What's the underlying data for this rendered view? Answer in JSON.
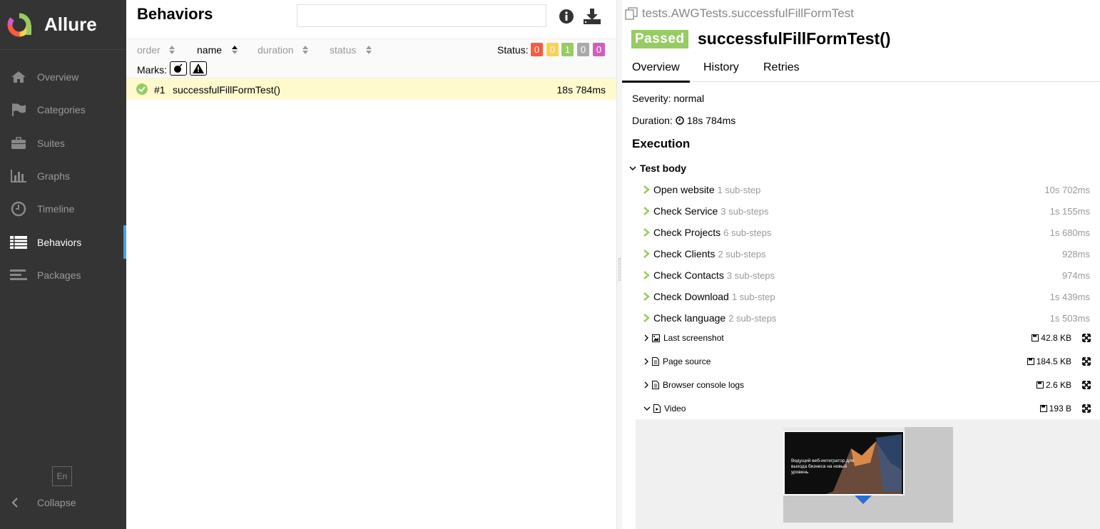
{
  "app": {
    "name": "Allure"
  },
  "sidebar": {
    "items": [
      {
        "label": "Overview",
        "icon": "home-icon",
        "active": false
      },
      {
        "label": "Categories",
        "icon": "flag-icon",
        "active": false
      },
      {
        "label": "Suites",
        "icon": "briefcase-icon",
        "active": false
      },
      {
        "label": "Graphs",
        "icon": "bar-chart-icon",
        "active": false
      },
      {
        "label": "Timeline",
        "icon": "clock-icon",
        "active": false
      },
      {
        "label": "Behaviors",
        "icon": "list-icon",
        "active": true
      },
      {
        "label": "Packages",
        "icon": "align-left-icon",
        "active": false
      }
    ],
    "language": "En",
    "collapse_label": "Collapse"
  },
  "behaviors": {
    "title": "Behaviors",
    "search": {
      "value": "",
      "placeholder": ""
    },
    "sort": {
      "order": "order",
      "name": "name",
      "duration": "duration",
      "status": "status"
    },
    "status_label": "Status:",
    "status_counts": [
      {
        "value": "0",
        "color": "#fd5a3e"
      },
      {
        "value": "0",
        "color": "#ffd050"
      },
      {
        "value": "1",
        "color": "#97cc64"
      },
      {
        "value": "0",
        "color": "#aaaaaa"
      },
      {
        "value": "0",
        "color": "#d35ebe"
      }
    ],
    "marks_label": "Marks:",
    "rows": [
      {
        "number": "#1",
        "name": "successfulFillFormTest()",
        "duration": "18s 784ms"
      }
    ]
  },
  "test": {
    "full_name": "tests.AWGTests.successfulFillFormTest",
    "status": "Passed",
    "title": "successfulFillFormTest()",
    "tabs": {
      "overview": "Overview",
      "history": "History",
      "retries": "Retries"
    },
    "severity": "Severity: normal",
    "duration_label": "Duration:",
    "duration": "18s 784ms",
    "execution_title": "Execution",
    "test_body_label": "Test body",
    "steps": [
      {
        "name": "Open website",
        "sub": "1 sub-step",
        "duration": "10s 702ms"
      },
      {
        "name": "Check Service",
        "sub": "3 sub-steps",
        "duration": "1s 155ms"
      },
      {
        "name": "Check Projects",
        "sub": "6 sub-steps",
        "duration": "1s 680ms"
      },
      {
        "name": "Check Clients",
        "sub": "2 sub-steps",
        "duration": "928ms"
      },
      {
        "name": "Check Contacts",
        "sub": "3 sub-steps",
        "duration": "974ms"
      },
      {
        "name": "Check Download",
        "sub": "1 sub-step",
        "duration": "1s 439ms"
      },
      {
        "name": "Check language",
        "sub": "2 sub-steps",
        "duration": "1s 503ms"
      }
    ],
    "attachments": [
      {
        "name": "Last screenshot",
        "size": "42.8 KB",
        "icon": "image-icon"
      },
      {
        "name": "Page source",
        "size": "184.5 KB",
        "icon": "file-icon"
      },
      {
        "name": "Browser console logs",
        "size": "2.6 KB",
        "icon": "file-icon"
      },
      {
        "name": "Video",
        "size": "193 B",
        "icon": "video-file-icon"
      }
    ],
    "video_caption": "Ведущий веб-интегратор для выхода бизнеса на новый уровень"
  },
  "colors": {
    "sidebar_bg": "#343434",
    "accent": "#4aa3df",
    "passed": "#97cc64",
    "row_highlight": "#fffacd",
    "step_chevron": "#97cc64"
  }
}
